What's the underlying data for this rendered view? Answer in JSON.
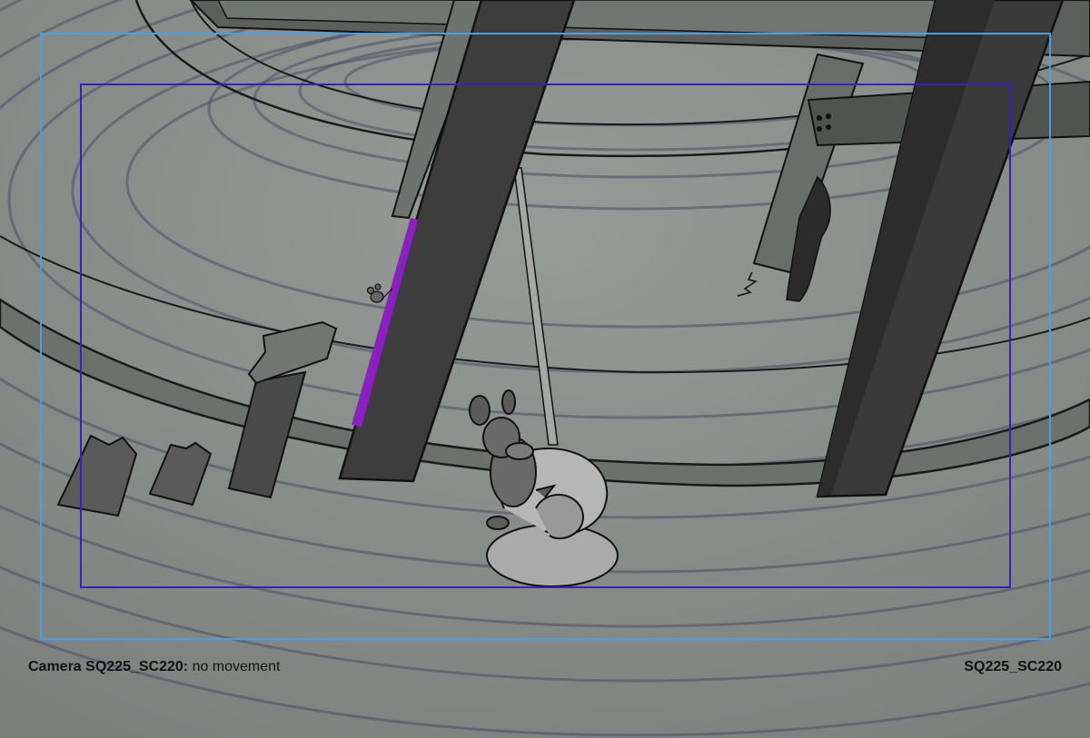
{
  "panel": {
    "camera_label": "Camera SQ225_SC220:",
    "camera_note": "no movement",
    "shot_id": "SQ225_SC220"
  },
  "colors": {
    "background": "#8a8f8b",
    "outer_frame": "#4a9ee6",
    "inner_frame": "#3a1fbf",
    "floor_ring": "#4a4e66",
    "pillar": "#3a3a3a",
    "accent": "#8a20c0"
  },
  "icons": {
    "character_main": "mouse-character",
    "character_small": "small-mouse-character"
  }
}
